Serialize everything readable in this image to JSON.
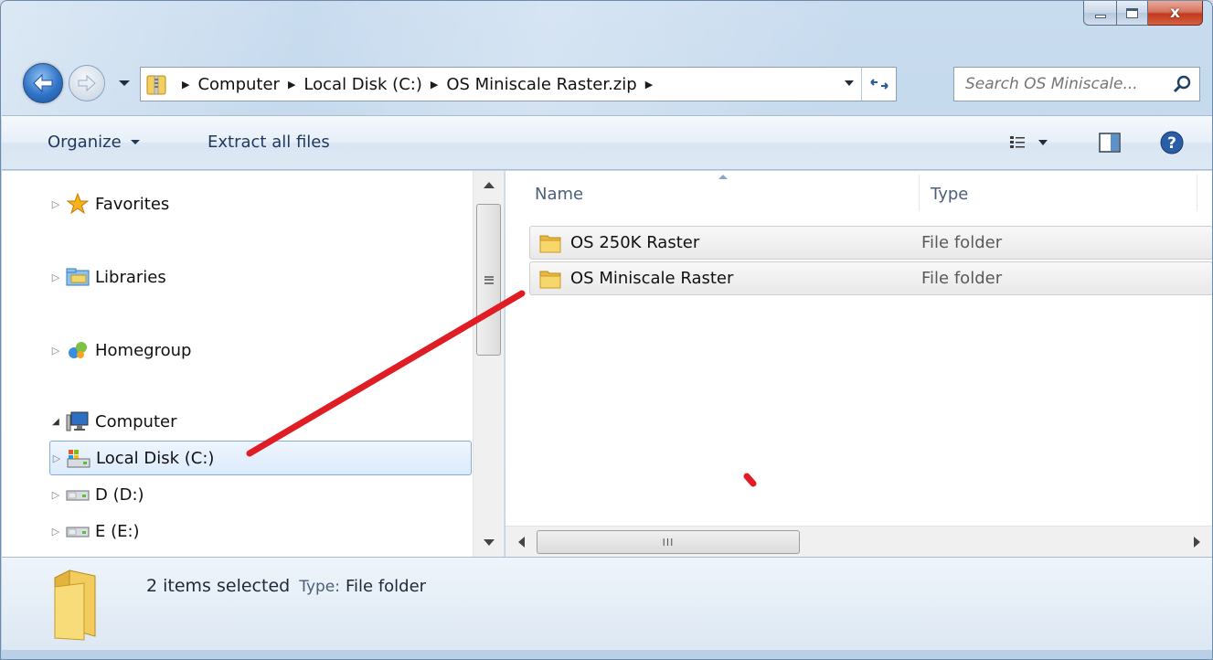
{
  "address_bar": {
    "crumbs": [
      "Computer",
      "Local Disk (C:)",
      "OS Miniscale Raster.zip"
    ]
  },
  "search": {
    "placeholder": "Search OS Miniscale..."
  },
  "command_bar": {
    "organize_label": "Organize",
    "extract_label": "Extract all files"
  },
  "nav_pane": {
    "items": [
      {
        "label": "Favorites",
        "icon": "star-icon",
        "expander": "▷"
      },
      {
        "label": "Libraries",
        "icon": "libraries-icon",
        "expander": "▷"
      },
      {
        "label": "Homegroup",
        "icon": "homegroup-icon",
        "expander": "▷"
      },
      {
        "label": "Computer",
        "icon": "computer-icon",
        "expander": "◢"
      },
      {
        "label": "Local Disk (C:)",
        "icon": "drive-icon",
        "expander": "▷",
        "selected": true
      },
      {
        "label": "D (D:)",
        "icon": "drive-icon",
        "expander": "▷"
      },
      {
        "label": "E (E:)",
        "icon": "drive-icon",
        "expander": "▷"
      }
    ]
  },
  "file_list": {
    "columns": {
      "name": "Name",
      "type": "Type"
    },
    "rows": [
      {
        "name": "OS 250K Raster",
        "type": "File folder"
      },
      {
        "name": "OS Miniscale Raster",
        "type": "File folder"
      }
    ],
    "hscroll_grip": "III"
  },
  "details": {
    "summary": "2 items selected",
    "type_label": "Type:",
    "type_value": "File folder"
  },
  "colors": {
    "accent": "#2f73c6",
    "selection_border": "#84acdd",
    "annotation_red": "#e01c24"
  }
}
